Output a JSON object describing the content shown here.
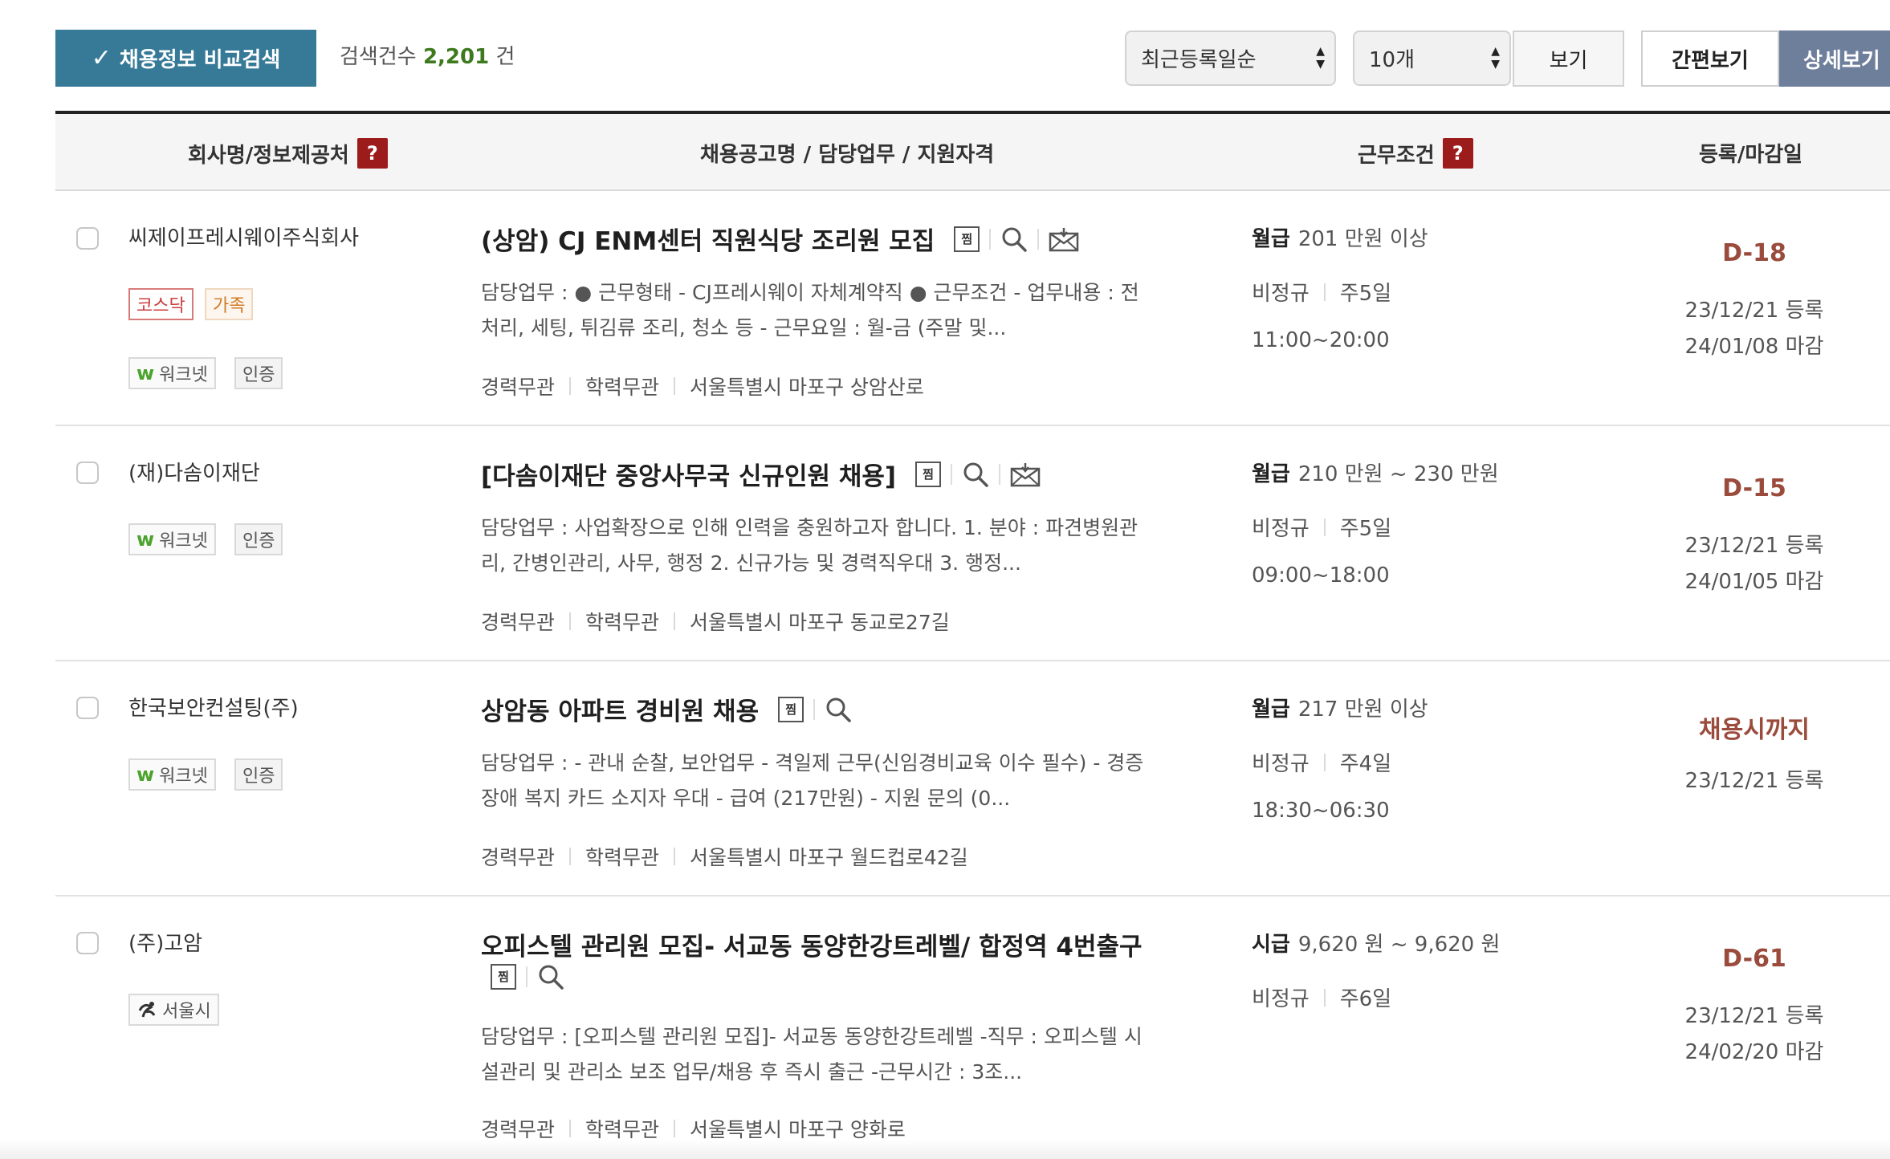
{
  "toolbar": {
    "compare_check": "✓",
    "compare_label": "채용정보 비교검색",
    "count_prefix": "검색건수",
    "count_value": "2,201",
    "count_suffix": "건",
    "sort_value": "최근등록일순",
    "per_page_value": "10개",
    "view_label": "보기",
    "simple_view_label": "간편보기",
    "detail_view_label": "상세보기"
  },
  "header": {
    "company": "회사명/정보제공처",
    "title": "채용공고명 / 담당업무 / 지원자격",
    "conditions": "근무조건",
    "dates": "등록/마감일",
    "help": "?"
  },
  "icons": {
    "scrap": "찜",
    "search": "magnifier-icon",
    "apply": "envelope-icon"
  },
  "jobs": [
    {
      "company": "씨제이프레시웨이주식회사",
      "tags": [
        "코스닥",
        "가족"
      ],
      "source": "워크넷",
      "cert": "인증",
      "title": "(상암) CJ ENM센터 직원식당 조리원 모집",
      "duty1": "담당업무 : ● 근무형태 - CJ프레시웨이 자체계약직 ● 근무조건 - 업무내용 : 전",
      "duty2": "처리, 세팅, 튀김류 조리, 청소 등 - 근무요일 : 월-금 (주말 및...",
      "experience": "경력무관",
      "education": "학력무관",
      "location": "서울특별시 마포구 상암산로",
      "pay_type": "월급",
      "pay": "201 만원 이상",
      "employment": "비정규",
      "days": "주5일",
      "hours": "11:00~20:00",
      "dday": "D-18",
      "registered": "23/12/21 등록",
      "deadline": "24/01/08 마감"
    },
    {
      "company": "(재)다솜이재단",
      "source": "워크넷",
      "cert": "인증",
      "title": "[다솜이재단 중앙사무국 신규인원 채용]",
      "duty1": "담당업무 : 사업확장으로 인해 인력을 충원하고자 합니다. 1. 분야 : 파견병원관",
      "duty2": "리, 간병인관리, 사무, 행정 2. 신규가능 및 경력직우대 3. 행정...",
      "experience": "경력무관",
      "education": "학력무관",
      "location": "서울특별시 마포구 동교로27길",
      "pay_type": "월급",
      "pay": "210 만원 ~ 230 만원",
      "employment": "비정규",
      "days": "주5일",
      "hours": "09:00~18:00",
      "dday": "D-15",
      "registered": "23/12/21 등록",
      "deadline": "24/01/05 마감"
    },
    {
      "company": "한국보안컨설팅(주)",
      "source": "워크넷",
      "cert": "인증",
      "title": "상암동 아파트 경비원 채용",
      "duty1": "담당업무 : - 관내 순찰, 보안업무 - 격일제 근무(신임경비교육 이수 필수) - 경증",
      "duty2": "장애 복지 카드 소지자 우대 - 급여 (217만원) - 지원 문의 (0...",
      "experience": "경력무관",
      "education": "학력무관",
      "location": "서울특별시 마포구 월드컵로42길",
      "pay_type": "월급",
      "pay": "217 만원 이상",
      "employment": "비정규",
      "days": "주4일",
      "hours": "18:30~06:30",
      "dday": "채용시까지",
      "registered": "23/12/21 등록"
    },
    {
      "company": "(주)고암",
      "source": "서울시",
      "title": "오피스텔 관리원 모집- 서교동 동양한강트레벨/ 합정역 4번출구",
      "duty1": "담당업무 : [오피스텔 관리원 모집]- 서교동 동양한강트레벨 -직무 : 오피스텔 시",
      "duty2": "설관리 및 관리소 보조 업무/채용 후 즉시 출근 -근무시간 : 3조...",
      "experience": "경력무관",
      "education": "학력무관",
      "location": "서울특별시 마포구 양화로",
      "pay_type": "시급",
      "pay": "9,620 원 ~ 9,620 원",
      "employment": "비정규",
      "days": "주6일",
      "dday": "D-61",
      "registered": "23/12/21 등록",
      "deadline": "24/02/20 마감"
    }
  ]
}
